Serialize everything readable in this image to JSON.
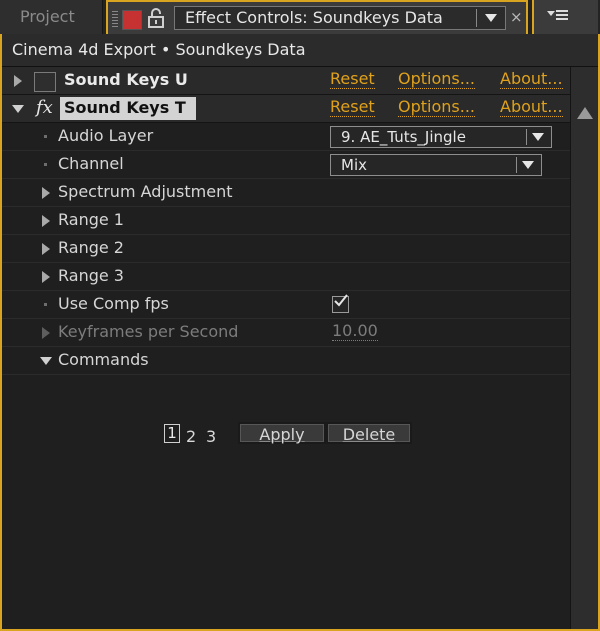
{
  "tabs": {
    "project_label": "Project",
    "active_label": "Effect Controls: Soundkeys Data",
    "close_glyph": "×"
  },
  "header": {
    "breadcrumb": "Cinema 4d Export • Soundkeys Data"
  },
  "effects": [
    {
      "name": "Sound Keys U",
      "expanded": false,
      "reset": "Reset",
      "options": "Options...",
      "about": "About..."
    },
    {
      "name": "Sound Keys T",
      "expanded": true,
      "fx": "fx",
      "reset": "Reset",
      "options": "Options...",
      "about": "About..."
    }
  ],
  "params": {
    "audio_layer": {
      "label": "Audio Layer",
      "value": "9. AE_Tuts_Jingle"
    },
    "channel": {
      "label": "Channel",
      "value": "Mix"
    },
    "spectrum": {
      "label": "Spectrum Adjustment"
    },
    "range1": {
      "label": "Range 1"
    },
    "range2": {
      "label": "Range 2"
    },
    "range3": {
      "label": "Range 3"
    },
    "use_comp_fps": {
      "label": "Use Comp fps",
      "checked": true
    },
    "keyframes_per_second": {
      "label": "Keyframes per Second",
      "value": "10.00"
    },
    "commands": {
      "label": "Commands",
      "expanded": true
    }
  },
  "commands": {
    "slots": [
      "1",
      "2",
      "3"
    ],
    "apply_label": "Apply",
    "delete_label": "Delete"
  },
  "colors": {
    "accent": "#d9a520",
    "link": "#e0a11b",
    "swatch": "#c63232"
  }
}
